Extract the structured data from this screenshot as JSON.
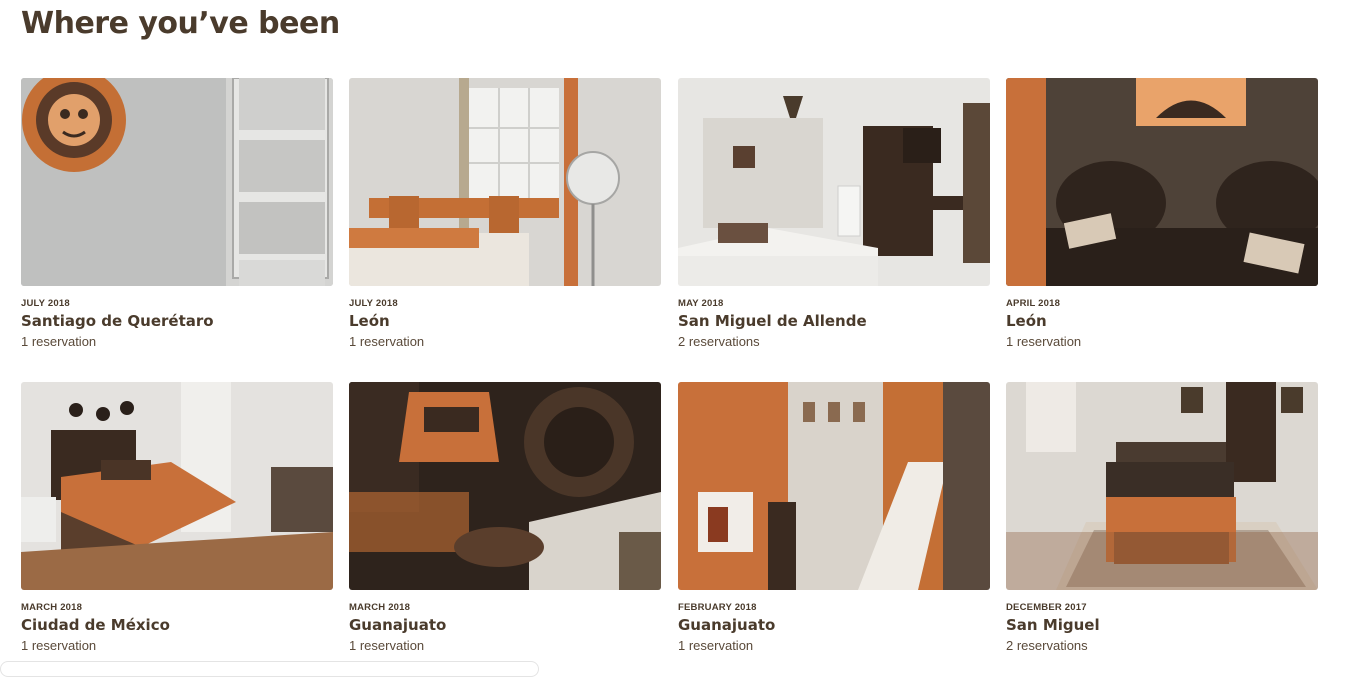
{
  "page": {
    "title": "Where you’ve been"
  },
  "colors": {
    "text": "#4a3b2c",
    "accent": "#c8703a",
    "dark": "#3a2a20"
  },
  "trips": [
    {
      "date": "JULY 2018",
      "city": "Santiago de Querétaro",
      "count": "1 reservation",
      "photo": "room-wall-sun-mask-door"
    },
    {
      "date": "JULY 2018",
      "city": "León",
      "count": "1 reservation",
      "photo": "room-desk-fan-window"
    },
    {
      "date": "MAY 2018",
      "city": "San Miguel de Allende",
      "count": "2 reservations",
      "photo": "room-bed-mirror-lamp"
    },
    {
      "date": "APRIL 2018",
      "city": "León",
      "count": "1 reservation",
      "photo": "bedroom-dark-wall-pillows"
    },
    {
      "date": "MARCH 2018",
      "city": "Ciudad de México",
      "count": "1 reservation",
      "photo": "bedroom-bed-armchair"
    },
    {
      "date": "MARCH 2018",
      "city": "Guanajuato",
      "count": "1 reservation",
      "photo": "mural-mask-art"
    },
    {
      "date": "FEBRUARY 2018",
      "city": "Guanajuato",
      "count": "1 reservation",
      "photo": "colonial-street-buildings"
    },
    {
      "date": "DECEMBER 2017",
      "city": "San Miguel",
      "count": "2 reservations",
      "photo": "living-room-sofa-table"
    }
  ]
}
